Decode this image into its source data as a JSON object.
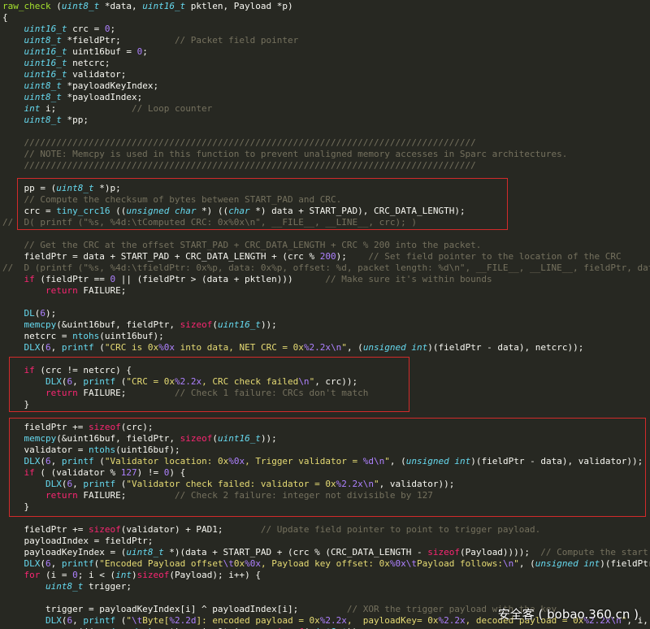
{
  "code_lines": [
    [
      [
        "fn",
        "raw_check"
      ],
      [
        "p",
        " ("
      ],
      [
        "t",
        "uint8_t"
      ],
      [
        "p",
        " *data, "
      ],
      [
        "t",
        "uint16_t"
      ],
      [
        "p",
        " pktlen, Payload *p)"
      ]
    ],
    [
      [
        "p",
        "{"
      ]
    ],
    [
      [
        "p",
        "    "
      ],
      [
        "t",
        "uint16_t"
      ],
      [
        "p",
        " crc = "
      ],
      [
        "n",
        "0"
      ],
      [
        "p",
        ";"
      ]
    ],
    [
      [
        "p",
        "    "
      ],
      [
        "t",
        "uint8_t"
      ],
      [
        "p",
        " *fieldPtr;          "
      ],
      [
        "c",
        "// Packet field pointer"
      ]
    ],
    [
      [
        "p",
        "    "
      ],
      [
        "t",
        "uint16_t"
      ],
      [
        "p",
        " uint16buf = "
      ],
      [
        "n",
        "0"
      ],
      [
        "p",
        ";"
      ]
    ],
    [
      [
        "p",
        "    "
      ],
      [
        "t",
        "uint16_t"
      ],
      [
        "p",
        " netcrc;"
      ]
    ],
    [
      [
        "p",
        "    "
      ],
      [
        "t",
        "uint16_t"
      ],
      [
        "p",
        " validator;"
      ]
    ],
    [
      [
        "p",
        "    "
      ],
      [
        "t",
        "uint8_t"
      ],
      [
        "p",
        " *payloadKeyIndex;"
      ]
    ],
    [
      [
        "p",
        "    "
      ],
      [
        "t",
        "uint8_t"
      ],
      [
        "p",
        " *payloadIndex;"
      ]
    ],
    [
      [
        "p",
        "    "
      ],
      [
        "t",
        "int"
      ],
      [
        "p",
        " i;              "
      ],
      [
        "c",
        "// Loop counter"
      ]
    ],
    [
      [
        "p",
        "    "
      ],
      [
        "t",
        "uint8_t"
      ],
      [
        "p",
        " *pp;"
      ]
    ],
    [
      [
        "p",
        ""
      ]
    ],
    [
      [
        "c",
        "    ////////////////////////////////////////////////////////////////////////////////////"
      ]
    ],
    [
      [
        "c",
        "    // NOTE: Memcpy is used in this function to prevent unaligned memory accesses in Sparc architectures."
      ]
    ],
    [
      [
        "c",
        "    ////////////////////////////////////////////////////////////////////////////////////"
      ]
    ],
    [
      [
        "p",
        ""
      ]
    ],
    [
      [
        "p",
        "    pp = ("
      ],
      [
        "t",
        "uint8_t"
      ],
      [
        "p",
        " *)p;"
      ]
    ],
    [
      [
        "c",
        "    // Compute the checksum of bytes between START_PAD and CRC."
      ]
    ],
    [
      [
        "p",
        "    crc = "
      ],
      [
        "f",
        "tiny_crc16"
      ],
      [
        "p",
        " (("
      ],
      [
        "t",
        "unsigned char"
      ],
      [
        "p",
        " *) (("
      ],
      [
        "t",
        "char"
      ],
      [
        "p",
        " *) data + START_PAD), CRC_DATA_LENGTH);"
      ]
    ],
    [
      [
        "c",
        "//  D( printf (\"%s, %4d:\\tComputed CRC: 0x%0x\\n\", __FILE__, __LINE__, crc); )"
      ]
    ],
    [
      [
        "p",
        ""
      ]
    ],
    [
      [
        "c",
        "    // Get the CRC at the offset START_PAD + CRC_DATA_LENGTH + CRC % 200 into the packet."
      ]
    ],
    [
      [
        "p",
        "    fieldPtr = data + START_PAD + CRC_DATA_LENGTH + (crc % "
      ],
      [
        "n",
        "200"
      ],
      [
        "p",
        ");    "
      ],
      [
        "c",
        "// Set field pointer to the location of the CRC"
      ]
    ],
    [
      [
        "c",
        "//  D (printf (\"%s, %4d:\\tfieldPtr: 0x%p, data: 0x%p, offset: %d, packet length: %d\\n\", __FILE__, __LINE__, fieldPtr, data, fieldPtr - data, pktlen); )"
      ]
    ],
    [
      [
        "p",
        "    "
      ],
      [
        "k",
        "if"
      ],
      [
        "p",
        " (fieldPtr == "
      ],
      [
        "n",
        "0"
      ],
      [
        "p",
        " || (fieldPtr > (data + pktlen)))      "
      ],
      [
        "c",
        "// Make sure it's within bounds"
      ]
    ],
    [
      [
        "p",
        "        "
      ],
      [
        "k",
        "return"
      ],
      [
        "p",
        " FAILURE;"
      ]
    ],
    [
      [
        "p",
        ""
      ]
    ],
    [
      [
        "p",
        "    "
      ],
      [
        "f",
        "DL"
      ],
      [
        "p",
        "("
      ],
      [
        "n",
        "6"
      ],
      [
        "p",
        ");"
      ]
    ],
    [
      [
        "p",
        "    "
      ],
      [
        "f",
        "memcpy"
      ],
      [
        "p",
        "(&uint16buf, fieldPtr, "
      ],
      [
        "k",
        "sizeof"
      ],
      [
        "p",
        "("
      ],
      [
        "t",
        "uint16_t"
      ],
      [
        "p",
        "));"
      ]
    ],
    [
      [
        "p",
        "    netcrc = "
      ],
      [
        "f",
        "ntohs"
      ],
      [
        "p",
        "(uint16buf);"
      ]
    ],
    [
      [
        "p",
        "    "
      ],
      [
        "f",
        "DLX"
      ],
      [
        "p",
        "("
      ],
      [
        "n",
        "6"
      ],
      [
        "p",
        ", "
      ],
      [
        "f",
        "printf"
      ],
      [
        "p",
        " ("
      ],
      [
        "s",
        "\"CRC is 0x"
      ],
      [
        "n",
        "%0x"
      ],
      [
        "s",
        " into data, NET CRC = 0x"
      ],
      [
        "n",
        "%2.2x"
      ],
      [
        "n",
        "\\n"
      ],
      [
        "s",
        "\""
      ],
      [
        "p",
        ", ("
      ],
      [
        "t",
        "unsigned int"
      ],
      [
        "p",
        ")(fieldPtr - data), netcrc));"
      ]
    ],
    [
      [
        "p",
        ""
      ]
    ],
    [
      [
        "p",
        "    "
      ],
      [
        "k",
        "if"
      ],
      [
        "p",
        " (crc != netcrc) {"
      ]
    ],
    [
      [
        "p",
        "        "
      ],
      [
        "f",
        "DLX"
      ],
      [
        "p",
        "("
      ],
      [
        "n",
        "6"
      ],
      [
        "p",
        ", "
      ],
      [
        "f",
        "printf"
      ],
      [
        "p",
        " ("
      ],
      [
        "s",
        "\"CRC = 0x"
      ],
      [
        "n",
        "%2.2x"
      ],
      [
        "s",
        ", CRC check failed"
      ],
      [
        "n",
        "\\n"
      ],
      [
        "s",
        "\""
      ],
      [
        "p",
        ", crc));"
      ]
    ],
    [
      [
        "p",
        "        "
      ],
      [
        "k",
        "return"
      ],
      [
        "p",
        " FAILURE;         "
      ],
      [
        "c",
        "// Check 1 failure: CRCs don't match"
      ]
    ],
    [
      [
        "p",
        "    }"
      ]
    ],
    [
      [
        "p",
        ""
      ]
    ],
    [
      [
        "p",
        "    fieldPtr += "
      ],
      [
        "k",
        "sizeof"
      ],
      [
        "p",
        "(crc);"
      ]
    ],
    [
      [
        "p",
        "    "
      ],
      [
        "f",
        "memcpy"
      ],
      [
        "p",
        "(&uint16buf, fieldPtr, "
      ],
      [
        "k",
        "sizeof"
      ],
      [
        "p",
        "("
      ],
      [
        "t",
        "uint16_t"
      ],
      [
        "p",
        "));"
      ]
    ],
    [
      [
        "p",
        "    validator = "
      ],
      [
        "f",
        "ntohs"
      ],
      [
        "p",
        "(uint16buf);"
      ]
    ],
    [
      [
        "p",
        "    "
      ],
      [
        "f",
        "DLX"
      ],
      [
        "p",
        "("
      ],
      [
        "n",
        "6"
      ],
      [
        "p",
        ", "
      ],
      [
        "f",
        "printf"
      ],
      [
        "p",
        " ("
      ],
      [
        "s",
        "\"Validator location: 0x"
      ],
      [
        "n",
        "%0x"
      ],
      [
        "s",
        ", Trigger validator = "
      ],
      [
        "n",
        "%d"
      ],
      [
        "n",
        "\\n"
      ],
      [
        "s",
        "\""
      ],
      [
        "p",
        ", ("
      ],
      [
        "t",
        "unsigned int"
      ],
      [
        "p",
        ")(fieldPtr - data), validator));"
      ]
    ],
    [
      [
        "p",
        "    "
      ],
      [
        "k",
        "if"
      ],
      [
        "p",
        " ( (validator % "
      ],
      [
        "n",
        "127"
      ],
      [
        "p",
        ") != "
      ],
      [
        "n",
        "0"
      ],
      [
        "p",
        ") {"
      ]
    ],
    [
      [
        "p",
        "        "
      ],
      [
        "f",
        "DLX"
      ],
      [
        "p",
        "("
      ],
      [
        "n",
        "6"
      ],
      [
        "p",
        ", "
      ],
      [
        "f",
        "printf"
      ],
      [
        "p",
        " ("
      ],
      [
        "s",
        "\"Validator check failed: validator = 0x"
      ],
      [
        "n",
        "%2.2x"
      ],
      [
        "n",
        "\\n"
      ],
      [
        "s",
        "\""
      ],
      [
        "p",
        ", validator));"
      ]
    ],
    [
      [
        "p",
        "        "
      ],
      [
        "k",
        "return"
      ],
      [
        "p",
        " FAILURE;         "
      ],
      [
        "c",
        "// Check 2 failure: integer not divisible by 127"
      ]
    ],
    [
      [
        "p",
        "    }"
      ]
    ],
    [
      [
        "p",
        ""
      ]
    ],
    [
      [
        "p",
        "    fieldPtr += "
      ],
      [
        "k",
        "sizeof"
      ],
      [
        "p",
        "(validator) + PAD1;       "
      ],
      [
        "c",
        "// Update field pointer to point to trigger payload."
      ]
    ],
    [
      [
        "p",
        "    payloadIndex = fieldPtr;"
      ]
    ],
    [
      [
        "p",
        "    payloadKeyIndex = ("
      ],
      [
        "t",
        "uint8_t"
      ],
      [
        "p",
        " *)(data + START_PAD + (crc % (CRC_DATA_LENGTH - "
      ],
      [
        "k",
        "sizeof"
      ],
      [
        "p",
        "(Payload))));  "
      ],
      [
        "c",
        "// Compute the start of the payload key"
      ]
    ],
    [
      [
        "p",
        "    "
      ],
      [
        "f",
        "DLX"
      ],
      [
        "p",
        "("
      ],
      [
        "n",
        "6"
      ],
      [
        "p",
        ", "
      ],
      [
        "f",
        "printf"
      ],
      [
        "p",
        "("
      ],
      [
        "s",
        "\"Encoded Payload offset"
      ],
      [
        "n",
        "\\t"
      ],
      [
        "s",
        "0x"
      ],
      [
        "n",
        "%0x"
      ],
      [
        "s",
        ", Payload key offset: 0x"
      ],
      [
        "n",
        "%0x"
      ],
      [
        "n",
        "\\t"
      ],
      [
        "s",
        "Payload follows:"
      ],
      [
        "n",
        "\\n"
      ],
      [
        "s",
        "\""
      ],
      [
        "p",
        ", ("
      ],
      [
        "t",
        "unsigned int"
      ],
      [
        "p",
        ")(fieldPtr - data),"
      ]
    ],
    [
      [
        "p",
        "    "
      ],
      [
        "k",
        "for"
      ],
      [
        "p",
        " (i = "
      ],
      [
        "n",
        "0"
      ],
      [
        "p",
        "; i < ("
      ],
      [
        "t",
        "int"
      ],
      [
        "p",
        ")"
      ],
      [
        "k",
        "sizeof"
      ],
      [
        "p",
        "(Payload); i++) {"
      ]
    ],
    [
      [
        "p",
        "        "
      ],
      [
        "t",
        "uint8_t"
      ],
      [
        "p",
        " trigger;"
      ]
    ],
    [
      [
        "p",
        ""
      ]
    ],
    [
      [
        "p",
        "        trigger = payloadKeyIndex[i] ^ payloadIndex[i];         "
      ],
      [
        "c",
        "// XOR the trigger payload with the key"
      ]
    ],
    [
      [
        "p",
        "        "
      ],
      [
        "f",
        "DLX"
      ],
      [
        "p",
        "("
      ],
      [
        "n",
        "6"
      ],
      [
        "p",
        ", "
      ],
      [
        "f",
        "printf"
      ],
      [
        "p",
        " ("
      ],
      [
        "s",
        "\""
      ],
      [
        "n",
        "\\t"
      ],
      [
        "s",
        "Byte["
      ],
      [
        "n",
        "%2.2d"
      ],
      [
        "s",
        "]: encoded payload = 0x"
      ],
      [
        "n",
        "%2.2x"
      ],
      [
        "s",
        ",  payloadKey= 0x"
      ],
      [
        "n",
        "%2.2x"
      ],
      [
        "s",
        ", decoded payload = 0x"
      ],
      [
        "n",
        "%2.2x"
      ],
      [
        "n",
        "\\n"
      ],
      [
        "s",
        "\""
      ],
      [
        "p",
        ", i, payloadIndex[i], payloadKeyIndex[i], trigger));"
      ]
    ],
    [
      [
        "p",
        "        "
      ],
      [
        "f",
        "memcpy"
      ],
      [
        "p",
        "((("
      ],
      [
        "t",
        "unsigned char"
      ],
      [
        "p",
        " *)p + i, &trigger, "
      ],
      [
        "k",
        "sizeof"
      ],
      [
        "p",
        "("
      ],
      [
        "t",
        "uint8_t"
      ],
      [
        "p",
        "));"
      ]
    ]
  ],
  "watermark": "安全客 ( bobao.360.cn )",
  "colors": {
    "background": "#272822",
    "default_text": "#f8f8f2",
    "type": "#66d9ef",
    "keyword": "#f92672",
    "comment": "#75715e",
    "string": "#e6db74",
    "number": "#ae81ff",
    "function_name": "#a6e22e",
    "highlight_box": "#d22b2b"
  }
}
